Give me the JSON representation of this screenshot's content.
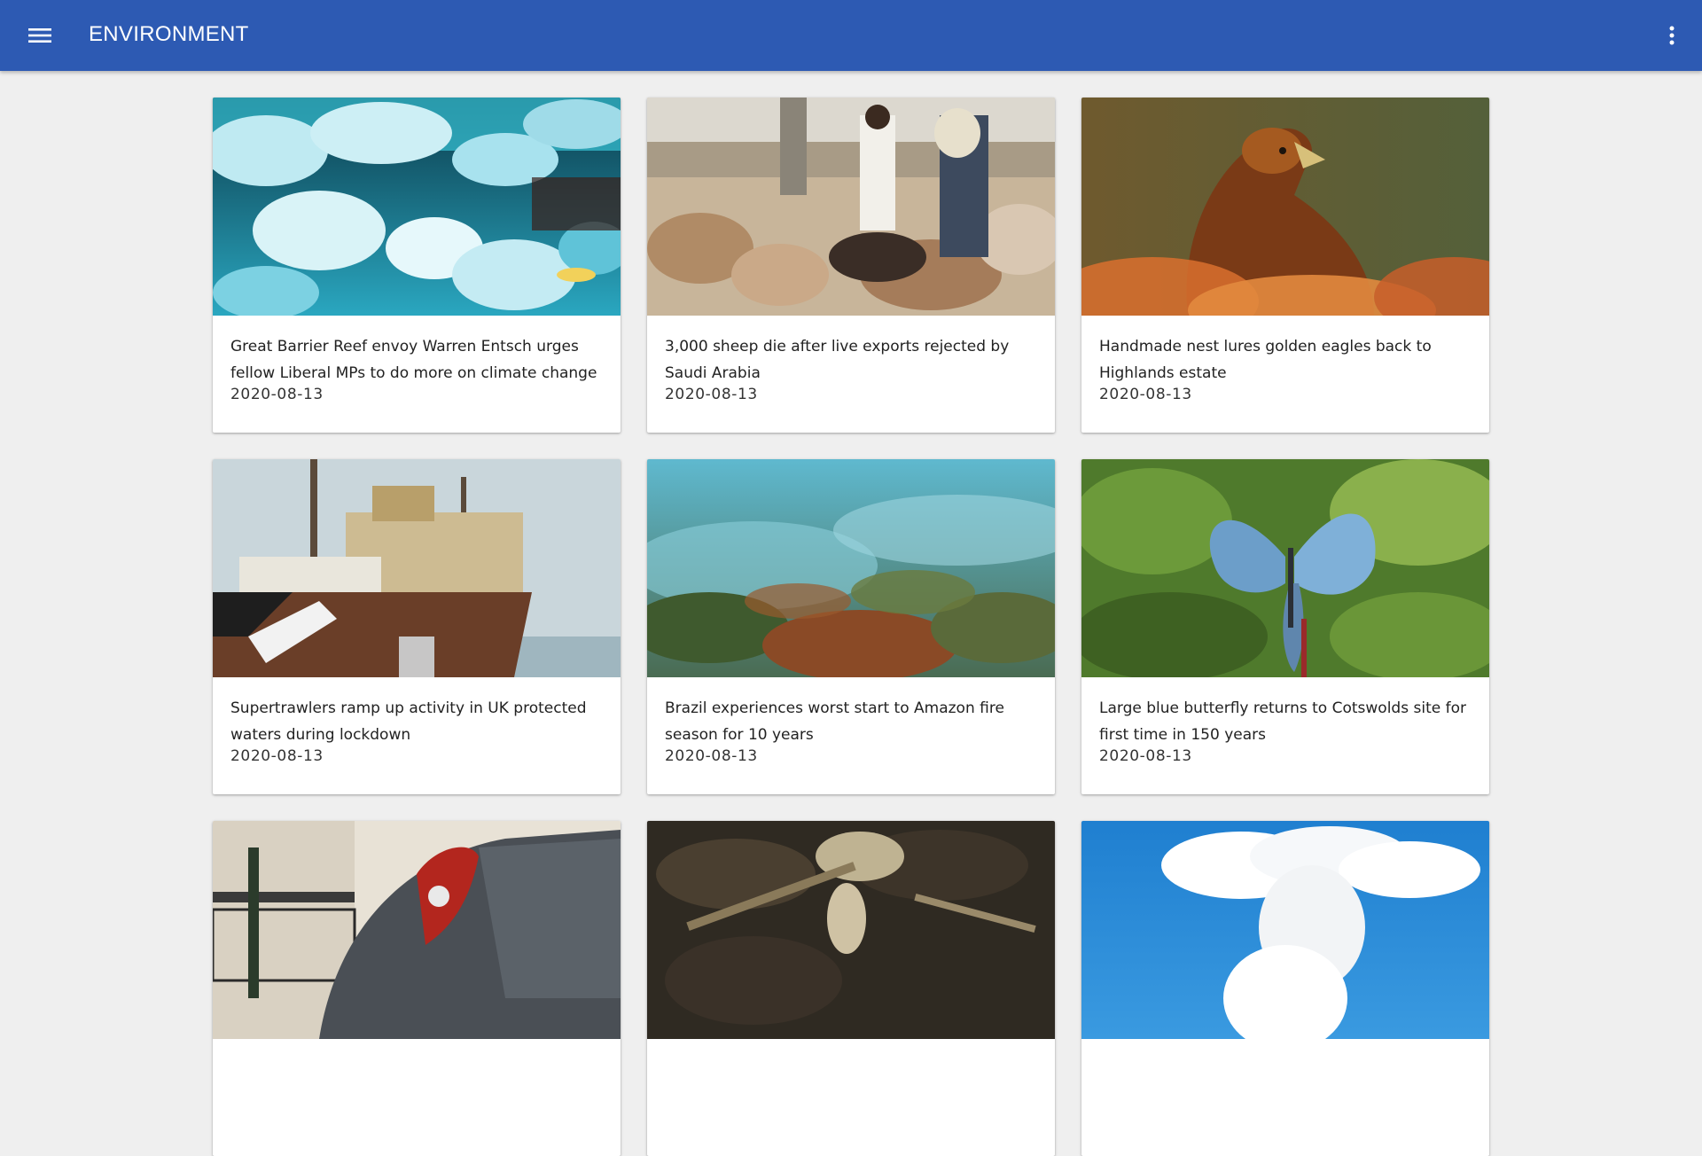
{
  "app": {
    "title": "ENVIRONMENT",
    "bar_color": "#2d5ab3"
  },
  "icons": {
    "menu": "hamburger-menu-icon",
    "more": "more-vertical-icon"
  },
  "articles": [
    {
      "title": "Great Barrier Reef envoy Warren Entsch urges fellow Liberal MPs to do more on climate change",
      "date": "2020-08-13",
      "image": "bleached coral reef"
    },
    {
      "title": "3,000 sheep die after live exports rejected by Saudi Arabia",
      "date": "2020-08-13",
      "image": "sheep market with two people"
    },
    {
      "title": "Handmade nest lures golden eagles back to Highlands estate",
      "date": "2020-08-13",
      "image": "golden eagle"
    },
    {
      "title": "Supertrawlers ramp up activity in UK protected waters during lockdown",
      "date": "2020-08-13",
      "image": "trawler ship"
    },
    {
      "title": "Brazil experiences worst start to Amazon fire season for 10 years",
      "date": "2020-08-13",
      "image": "smoking forest"
    },
    {
      "title": "Large blue butterfly returns to Cotswolds site for first time in 150 years",
      "date": "2020-08-13",
      "image": "blue butterfly on foliage"
    },
    {
      "title": "",
      "date": "",
      "image": "car rear light and charging post"
    },
    {
      "title": "",
      "date": "",
      "image": "forest floor with fungus"
    },
    {
      "title": "",
      "date": "",
      "image": "cumulus cloud in blue sky"
    }
  ]
}
